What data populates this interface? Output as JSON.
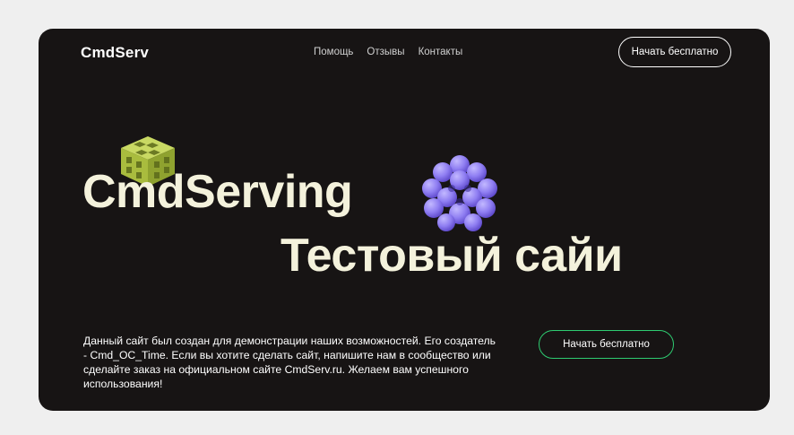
{
  "header": {
    "logo": "CmdServ",
    "nav": [
      {
        "label": "Помощь"
      },
      {
        "label": "Отзывы"
      },
      {
        "label": "Контакты"
      }
    ],
    "cta_label": "Начать бесплатно"
  },
  "hero": {
    "title_line1": "CmdServing",
    "title_line2": "Тестовый сайи",
    "description": "Данный сайт был создан для демонстрации наших возможностей. Его создатель - Cmd_OC_Time. Если вы хотите сделать сайт, напишите нам в сообщество или сделайте заказ на официальном сайте CmdServ.ru. Желаем вам успешного использования!",
    "cta_label": "Начать бесплатно"
  },
  "colors": {
    "page_background": "#efefef",
    "card_background": "#171414",
    "title_text": "#f4f2dc",
    "cta_border_accent": "#2ecc71",
    "cube_green": "#b9cc4f",
    "cube_purple": "#8d7cf0"
  },
  "icons": {
    "green_cube": "green-lattice-cube-icon",
    "purple_cube": "purple-rounded-cube-icon"
  }
}
